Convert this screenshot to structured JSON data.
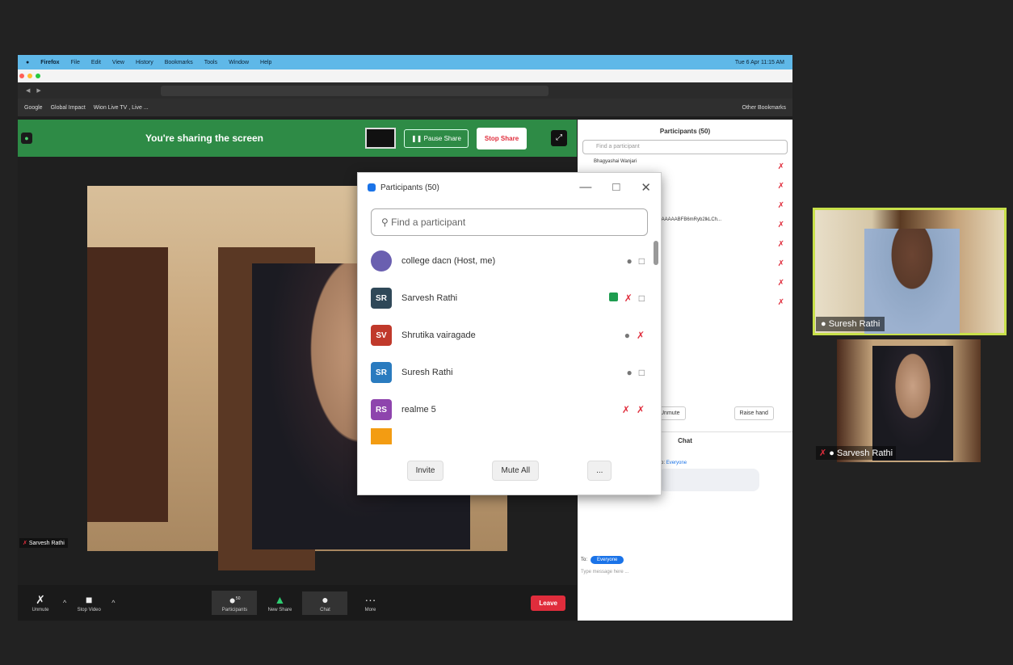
{
  "menubar": {
    "app": "Firefox",
    "items": [
      "File",
      "Edit",
      "View",
      "History",
      "Bookmarks",
      "Tools",
      "Window",
      "Help"
    ],
    "clock": "Tue 6 Apr 11:15 AM"
  },
  "bookmarks": {
    "items": [
      "Google",
      "Global Impact",
      "Wion Live TV , Live ..."
    ],
    "other": "Other Bookmarks"
  },
  "share_bar": {
    "text": "You're sharing the screen",
    "pause": "Pause Share",
    "stop": "Stop Share"
  },
  "main_video": {
    "name": "Sarvesh Rathi"
  },
  "toolbar": {
    "unmute": "Unmute",
    "stop_video": "Stop Video",
    "participants": "Participants",
    "new_share": "New Share",
    "chat": "Chat",
    "more": "More",
    "leave": "Leave",
    "participant_count": "50"
  },
  "bg_panel": {
    "title": "Participants (50)",
    "search": "Find a participant",
    "first": "Bhagyashai Wanjari",
    "truncated": "TSAAAAABFB6mRyb2lkLCh...",
    "unmute": "Unmute",
    "raise_hand": "Raise hand",
    "chat_title": "Chat",
    "to_label": "To:",
    "everyone": "Everyone",
    "type_placeholder": "Type message here ..."
  },
  "popup": {
    "title": "Participants (50)",
    "search": "Find a participant",
    "rows": [
      {
        "initials": "",
        "name": "college dacn (Host, me)",
        "color": "#6a5fb0"
      },
      {
        "initials": "SR",
        "name": "Sarvesh Rathi",
        "color": "#2f4858"
      },
      {
        "initials": "SV",
        "name": "Shrutika vairagade",
        "color": "#c0392b"
      },
      {
        "initials": "SR",
        "name": "Suresh Rathi",
        "color": "#2a7bbf"
      },
      {
        "initials": "RS",
        "name": "realme 5",
        "color": "#8e44ad"
      }
    ],
    "invite": "Invite",
    "mute_all": "Mute All",
    "more": "..."
  },
  "gallery": {
    "tile1_name": "Suresh Rathi",
    "tile2_name": "Sarvesh Rathi"
  }
}
